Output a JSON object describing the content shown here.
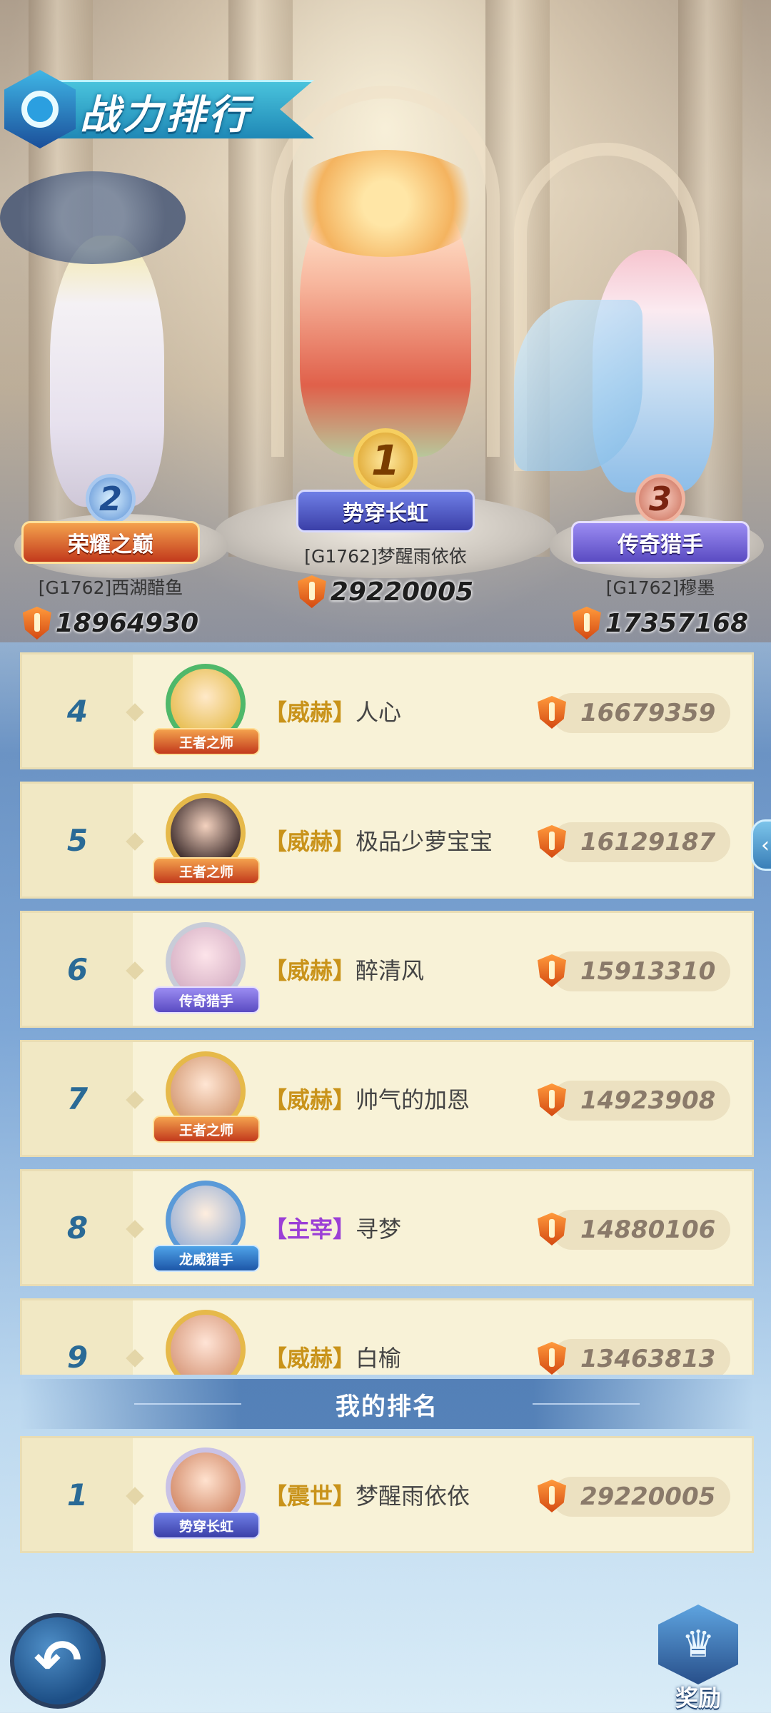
{
  "header": {
    "title": "战力排行"
  },
  "top3": [
    {
      "rank": "2",
      "title": "荣耀之巅",
      "name": "[G1762]西湖醋鱼",
      "power": "18964930"
    },
    {
      "rank": "1",
      "title": "势穿长虹",
      "name": "[G1762]梦醒雨依依",
      "power": "29220005"
    },
    {
      "rank": "3",
      "title": "传奇猎手",
      "name": "[G1762]穆墨",
      "power": "17357168"
    }
  ],
  "list": [
    {
      "rank": "4",
      "badge": "王者之师",
      "tag": "【威赫】",
      "name": "人心",
      "power": "16679359"
    },
    {
      "rank": "5",
      "badge": "王者之师",
      "tag": "【威赫】",
      "name": "极品少萝宝宝",
      "power": "16129187"
    },
    {
      "rank": "6",
      "badge": "传奇猎手",
      "tag": "【威赫】",
      "name": "醉清风",
      "power": "15913310"
    },
    {
      "rank": "7",
      "badge": "王者之师",
      "tag": "【威赫】",
      "name": "帅气的加恩",
      "power": "14923908"
    },
    {
      "rank": "8",
      "badge": "龙威猎手",
      "tag": "【主宰】",
      "name": "寻梦",
      "power": "14880106"
    },
    {
      "rank": "9",
      "badge": "",
      "tag": "【威赫】",
      "name": "白榆",
      "power": "13463813"
    }
  ],
  "my_rank": {
    "label": "我的排名",
    "rank": "1",
    "badge": "势穿长虹",
    "tag": "【震世】",
    "name": "梦醒雨依依",
    "power": "29220005"
  },
  "buttons": {
    "reward": "奖励"
  },
  "colors": {
    "tag_gold": "#c9931a",
    "tag_purple": "#9b3fd6",
    "rank_blue": "#2a6a96",
    "row_bg": "#f8f2d7"
  }
}
